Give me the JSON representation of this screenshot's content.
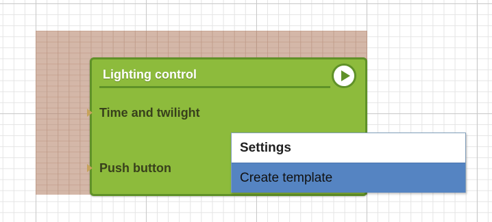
{
  "block": {
    "title": "Lighting control",
    "inputs": [
      {
        "label": "Time and twilight"
      },
      {
        "label": "Push button"
      }
    ],
    "play_icon": "play-icon"
  },
  "context_menu": {
    "items": [
      {
        "label": "Settings",
        "highlighted": false
      },
      {
        "label": "Create template",
        "highlighted": true
      }
    ]
  },
  "colors": {
    "block_fill": "#8dbb3c",
    "block_border": "#5f9128",
    "selection": "#c9a08c",
    "menu_highlight": "#5584c2",
    "port": "#c7a35c"
  }
}
